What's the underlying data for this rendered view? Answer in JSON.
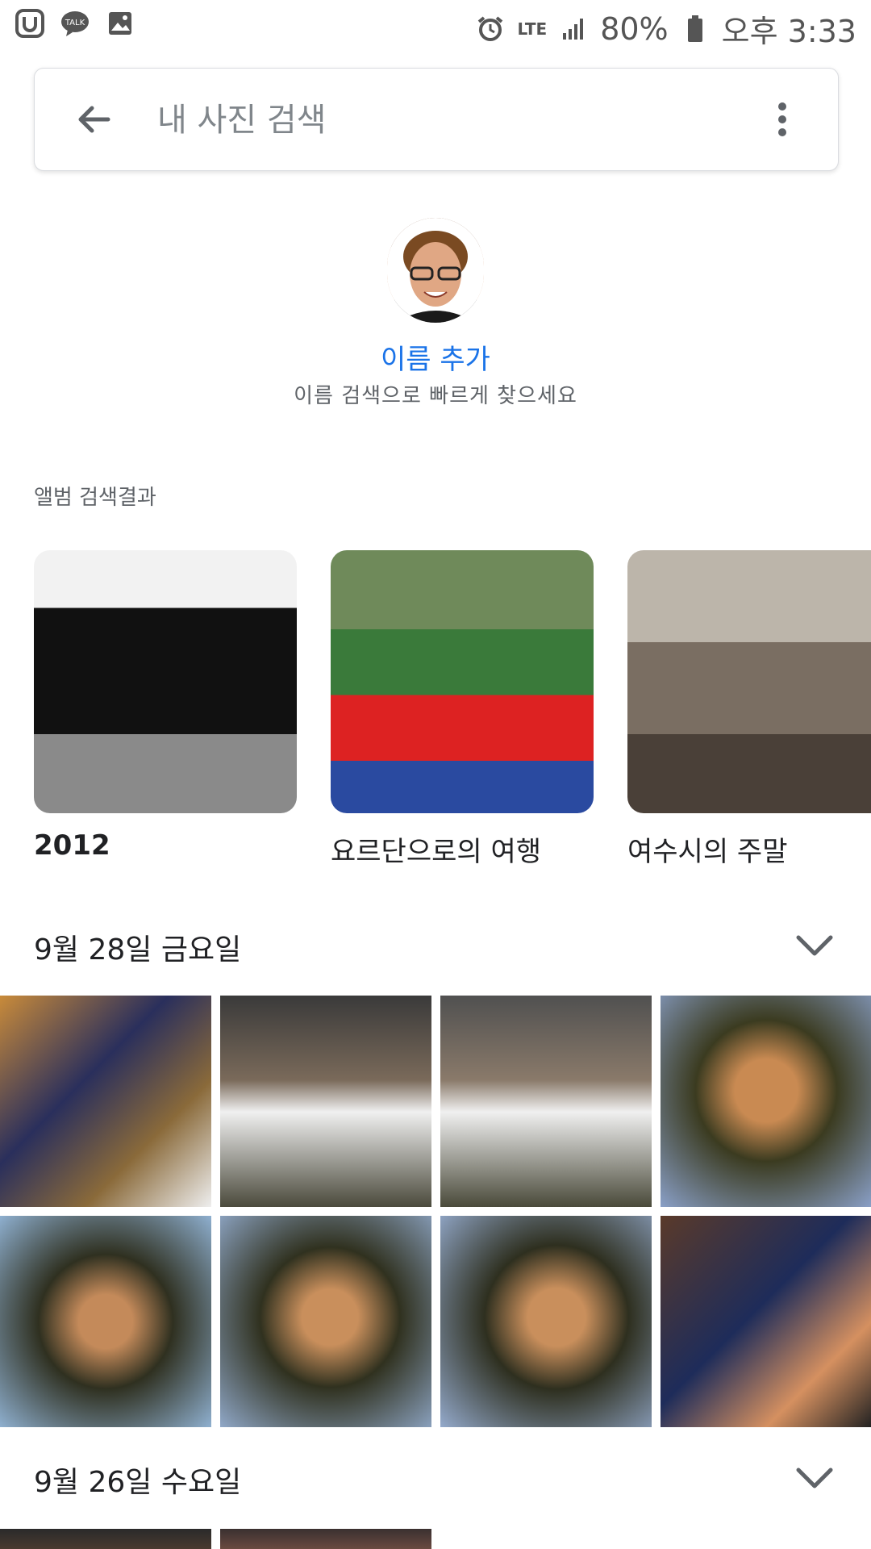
{
  "status_bar": {
    "left_icons": [
      "u-plus-icon",
      "kakaotalk-icon",
      "gallery-icon"
    ],
    "network": "LTE",
    "battery": "80%",
    "time": "오후 3:33"
  },
  "search": {
    "placeholder": "내 사진 검색"
  },
  "face": {
    "add_name_label": "이름 추가",
    "hint": "이름 검색으로 빠르게 찾으세요"
  },
  "albums": {
    "section_label": "앨범 검색결과",
    "items": [
      {
        "title": "2012"
      },
      {
        "title": "요르단으로의 여행"
      },
      {
        "title": "여수시의 주말"
      }
    ]
  },
  "date_groups": [
    {
      "label": "9월 28일 금요일",
      "photo_count_visible": 8
    },
    {
      "label": "9월 26일 수요일",
      "photo_count_visible": 2
    }
  ]
}
